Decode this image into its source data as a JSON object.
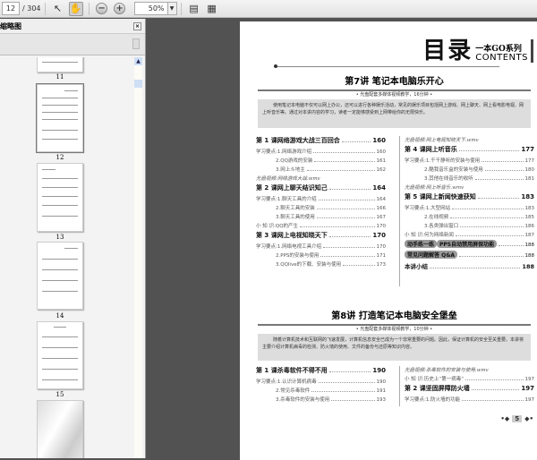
{
  "toolbar": {
    "page_current": "12",
    "page_total": "/ 304",
    "zoom": "50%"
  },
  "sidebar": {
    "title": "缩略图",
    "thumbnails": [
      {
        "label": "11"
      },
      {
        "label": "12"
      },
      {
        "label": "13"
      },
      {
        "label": "14"
      },
      {
        "label": "15"
      }
    ]
  },
  "page": {
    "title_big": "目录",
    "title_series": "一本GO系列",
    "title_en": "CONTENTS",
    "chapters": [
      {
        "title": "第7讲  笔记本电脑乐开心",
        "subtitle": "• 光盘配套多媒体视频教学，16分钟 •",
        "intro": "使用笔记本电脑不仅可以网上办公，还可以进行各种娱乐活动，常见的娱乐项目包括网上游戏、网上聊天、网上看电影电视、网上听音乐等。通过对本讲内容的学习，读者一定能够感受到上网带给你的无限快乐。",
        "left": [
          {
            "type": "lesson",
            "lab": "第 1 课  ",
            "txt": "网络游戏大战三百回合",
            "page": "160"
          },
          {
            "type": "point",
            "lab": "学习要点: ",
            "txt": "1.网络游戏介绍",
            "page": "160"
          },
          {
            "type": "indent",
            "lab": "",
            "txt": "2.QQ游戏的安装",
            "page": "161"
          },
          {
            "type": "indent",
            "lab": "",
            "txt": "3.网上斗地主",
            "page": "162"
          },
          {
            "type": "video",
            "lab": "光盘视频: ",
            "txt": "网络游戏大战.wmv",
            "page": ""
          },
          {
            "type": "lesson",
            "lab": "第 2 课  ",
            "txt": "网上聊天结识知己",
            "page": "164"
          },
          {
            "type": "point",
            "lab": "学习要点: ",
            "txt": "1.聊天工具的介绍",
            "page": "164"
          },
          {
            "type": "indent",
            "lab": "",
            "txt": "2.聊天工具的安装",
            "page": "166"
          },
          {
            "type": "indent",
            "lab": "",
            "txt": "3.聊天工具的使用",
            "page": "167"
          },
          {
            "type": "point",
            "lab": "小 知 识: ",
            "txt": "QQ的产生",
            "page": "170"
          },
          {
            "type": "lesson",
            "lab": "第 3 课  ",
            "txt": "网上电视知晓天下",
            "page": "170"
          },
          {
            "type": "point",
            "lab": "学习要点: ",
            "txt": "1.网络电视工具介绍",
            "page": "170"
          },
          {
            "type": "indent",
            "lab": "",
            "txt": "2.PPS的安装与使用",
            "page": "171"
          },
          {
            "type": "indent",
            "lab": "",
            "txt": "3.QQlive的下载、安装与使用",
            "page": "173"
          }
        ],
        "right": [
          {
            "type": "video",
            "lab": "光盘视频: ",
            "txt": "网上电视知晓天下.wmv",
            "page": ""
          },
          {
            "type": "lesson",
            "lab": "第 4 课  ",
            "txt": "网上听音乐",
            "page": "177"
          },
          {
            "type": "point",
            "lab": "学习要点: ",
            "txt": "1.千千静听的安装与使用",
            "page": "177"
          },
          {
            "type": "indent",
            "lab": "",
            "txt": "2.酷我音乐盒的安装与使用",
            "page": "180"
          },
          {
            "type": "indent",
            "lab": "",
            "txt": "3.其他在线音乐的收听",
            "page": "181"
          },
          {
            "type": "video",
            "lab": "光盘视频: ",
            "txt": "网上听音乐.wmv",
            "page": ""
          },
          {
            "type": "lesson",
            "lab": "第 5 课  ",
            "txt": "网上新闻快速获知",
            "page": "183"
          },
          {
            "type": "point",
            "lab": "学习要点: ",
            "txt": "1.大型网站",
            "page": "183"
          },
          {
            "type": "indent",
            "lab": "",
            "txt": "2.在线视频",
            "page": "185"
          },
          {
            "type": "indent",
            "lab": "",
            "txt": "3.各类弹出窗口",
            "page": "186"
          },
          {
            "type": "point",
            "lab": "小 知 识: ",
            "txt": "何为网络新闻",
            "page": "187"
          },
          {
            "type": "special",
            "lab": "动手练一练",
            "txt": " PPS自动禁用屏保功能",
            "page": "188"
          },
          {
            "type": "special",
            "lab": "",
            "txt": "常见问题解答 Q&A",
            "page": "188"
          },
          {
            "type": "summary",
            "lab": "",
            "txt": "本讲小结",
            "page": "188"
          }
        ]
      },
      {
        "title": "第8讲  打造笔记本电脑安全堡垒",
        "subtitle": "• 光盘配套多媒体视频教学，10分钟 •",
        "intro": "随着计算机技术和互联网的飞速发展，计算机信息安全已成为一个非常重要的问题。因此，保证计算机的安全至关重要。本讲将主要介绍计算机病毒的检测、防火墙的使用、文件的备份与还原等知识内容。",
        "left": [
          {
            "type": "lesson",
            "lab": "第 1 课  ",
            "txt": "杀毒软件不得不用",
            "page": "190"
          },
          {
            "type": "point",
            "lab": "学习要点: ",
            "txt": "1.认识计算机病毒",
            "page": "190"
          },
          {
            "type": "indent",
            "lab": "",
            "txt": "2.常见杀毒软件",
            "page": "191"
          },
          {
            "type": "indent",
            "lab": "",
            "txt": "3.杀毒软件的安装与使用",
            "page": "193"
          }
        ],
        "right": [
          {
            "type": "video",
            "lab": "光盘视频: ",
            "txt": "杀毒软件的安装与使用.wmv",
            "page": ""
          },
          {
            "type": "point",
            "lab": "小 知 识: ",
            "txt": "历史上“第一病毒”",
            "page": "197"
          },
          {
            "type": "lesson",
            "lab": "第 2 课  ",
            "txt": "坚固屏障防火墙",
            "page": "197"
          },
          {
            "type": "point",
            "lab": "学习要点: ",
            "txt": "1.防火墙的功能",
            "page": "197"
          }
        ]
      }
    ],
    "page_number": "5"
  }
}
